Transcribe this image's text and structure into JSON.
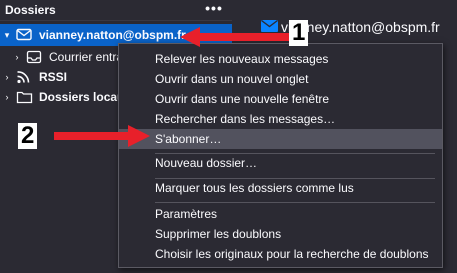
{
  "folder_pane": {
    "title": "Dossiers",
    "menu_glyph": "•••",
    "rows": [
      {
        "label": "vianney.natton@obspm.fr",
        "icon": "mail-account-icon",
        "twisty": "▾",
        "bold": true
      },
      {
        "label": "Courrier entrant",
        "icon": "inbox-icon",
        "twisty": "›",
        "bold": false
      },
      {
        "label": "RSSI",
        "icon": "rss-icon",
        "twisty": "›",
        "bold": true
      },
      {
        "label": "Dossiers locaux",
        "icon": "folder-icon",
        "twisty": "›",
        "bold": true
      }
    ]
  },
  "account_header": {
    "email": "vianney.natton@obspm.fr",
    "icon": "mail-icon"
  },
  "context_menu": {
    "items": [
      {
        "label": "Relever les nouveaux messages"
      },
      {
        "label": "Ouvrir dans un nouvel onglet"
      },
      {
        "label": "Ouvrir dans une nouvelle fenêtre"
      },
      {
        "label": "Rechercher dans les messages…"
      },
      {
        "label": "S'abonner…",
        "highlighted": true
      },
      {
        "label": "Nouveau dossier…"
      },
      {
        "label": "Marquer tous les dossiers comme lus"
      },
      {
        "label": "Paramètres"
      },
      {
        "label": "Supprimer les doublons"
      },
      {
        "label": "Choisir les originaux pour la recherche de doublons"
      }
    ]
  },
  "annotations": {
    "step1": "1",
    "step2": "2",
    "arrow_color": "#e8202a"
  },
  "colors": {
    "background": "#2b2a33",
    "selection": "#0a63c9",
    "menu_highlight": "#52525e",
    "text": "#fbfbfe"
  }
}
